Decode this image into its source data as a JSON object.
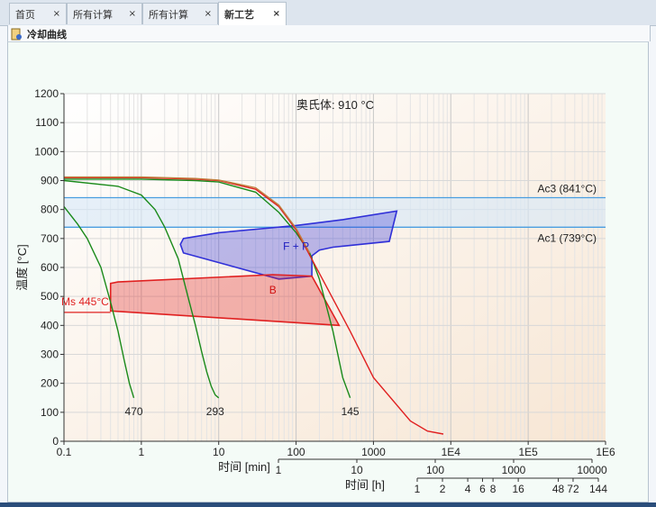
{
  "tabs": [
    {
      "label": "首页",
      "close": "×"
    },
    {
      "label": "所有计算",
      "close": "×"
    },
    {
      "label": "所有计算",
      "close": "×"
    },
    {
      "label": "新工艺",
      "close": "×"
    }
  ],
  "panel": {
    "title": "冷却曲线"
  },
  "chart_data": {
    "type": "line",
    "title": "奥氏体: 910 °C",
    "xlabel": "时间 [min]",
    "ylabel": "温度 [°C]",
    "x_scale": "log",
    "xlim": [
      0.1,
      1000000
    ],
    "ylim": [
      0,
      1200
    ],
    "x_tick_labels": [
      "0.1",
      "1",
      "10",
      "100",
      "1000",
      "1E4",
      "1E5",
      "1E6"
    ],
    "y_ticks": [
      0,
      100,
      200,
      300,
      400,
      500,
      600,
      700,
      800,
      900,
      1000,
      1100,
      1200
    ],
    "min_axis": {
      "label": "时间 [min]",
      "tick_labels": [
        "1",
        "10",
        "100",
        "1000",
        "10000"
      ],
      "values": [
        1,
        10,
        100,
        1000,
        10000
      ]
    },
    "hour_axis": {
      "label": "时间 [h]",
      "tick_labels": [
        "1",
        "2",
        "4",
        "6",
        "8",
        "16",
        "48",
        "72",
        "144"
      ],
      "values": [
        1,
        2,
        4,
        6,
        8,
        16,
        48,
        72,
        144
      ]
    },
    "grid": true,
    "bands": [
      {
        "label": "Ac3 (841°C)",
        "value": 841,
        "color": "#4a9ee0"
      },
      {
        "label": "Ac1 (739°C)",
        "value": 739,
        "color": "#4a9ee0"
      }
    ],
    "ms_line": {
      "label": "Ms 445°C",
      "value": 445,
      "color": "#e02020"
    },
    "regions": [
      {
        "label": "F + P",
        "color": "#3030d8",
        "outline": [
          [
            3.5,
            650
          ],
          [
            3.2,
            680
          ],
          [
            3.5,
            700
          ],
          [
            10,
            720
          ],
          [
            100,
            745
          ],
          [
            400,
            765
          ],
          [
            2000,
            795
          ],
          [
            1600,
            690
          ],
          [
            300,
            670
          ],
          [
            200,
            660
          ],
          [
            160,
            640
          ],
          [
            160,
            570
          ],
          [
            60,
            560
          ],
          [
            3.5,
            650
          ]
        ]
      },
      {
        "label": "B",
        "color": "#e02020",
        "outline": [
          [
            0.4,
            545
          ],
          [
            0.5,
            550
          ],
          [
            50,
            575
          ],
          [
            160,
            570
          ],
          [
            360,
            400
          ],
          [
            0.4,
            450
          ],
          [
            0.4,
            545
          ]
        ]
      }
    ],
    "series": [
      {
        "label": "470",
        "color": "#1a8a1a",
        "x": [
          0.1,
          0.15,
          0.2,
          0.3,
          0.4,
          0.5,
          0.6,
          0.7,
          0.8
        ],
        "y": [
          810,
          750,
          700,
          600,
          480,
          380,
          280,
          200,
          150
        ]
      },
      {
        "label": "293",
        "color": "#1a8a1a",
        "x": [
          0.1,
          0.5,
          1,
          1.5,
          2,
          3,
          4,
          5,
          6,
          7,
          8,
          9,
          10
        ],
        "y": [
          900,
          880,
          850,
          800,
          740,
          630,
          500,
          400,
          310,
          240,
          190,
          160,
          150
        ]
      },
      {
        "label": "145",
        "color": "#1a8a1a",
        "x": [
          0.1,
          1,
          5,
          10,
          30,
          60,
          100,
          150,
          200,
          300,
          400,
          500
        ],
        "y": [
          905,
          905,
          900,
          895,
          860,
          790,
          720,
          650,
          560,
          380,
          220,
          150
        ]
      },
      {
        "color": "#e02020",
        "x": [
          0.1,
          1,
          5,
          10,
          30,
          60,
          100,
          200,
          500,
          1000,
          3000,
          5000,
          8000
        ],
        "y": [
          910,
          910,
          905,
          900,
          870,
          810,
          730,
          580,
          380,
          220,
          70,
          35,
          25
        ]
      },
      {
        "color": "#c08040",
        "x": [
          0.1,
          1,
          5,
          10,
          30,
          60,
          100,
          150
        ],
        "y": [
          912,
          912,
          907,
          902,
          875,
          815,
          735,
          650
        ]
      }
    ],
    "curve_labels": [
      {
        "label": "470",
        "x": 0.8,
        "y": 90
      },
      {
        "label": "293",
        "x": 9,
        "y": 90
      },
      {
        "label": "145",
        "x": 500,
        "y": 90
      },
      {
        "label": "F + P",
        "x": 100,
        "y": 660
      },
      {
        "label": "B",
        "x": 50,
        "y": 510
      }
    ]
  }
}
